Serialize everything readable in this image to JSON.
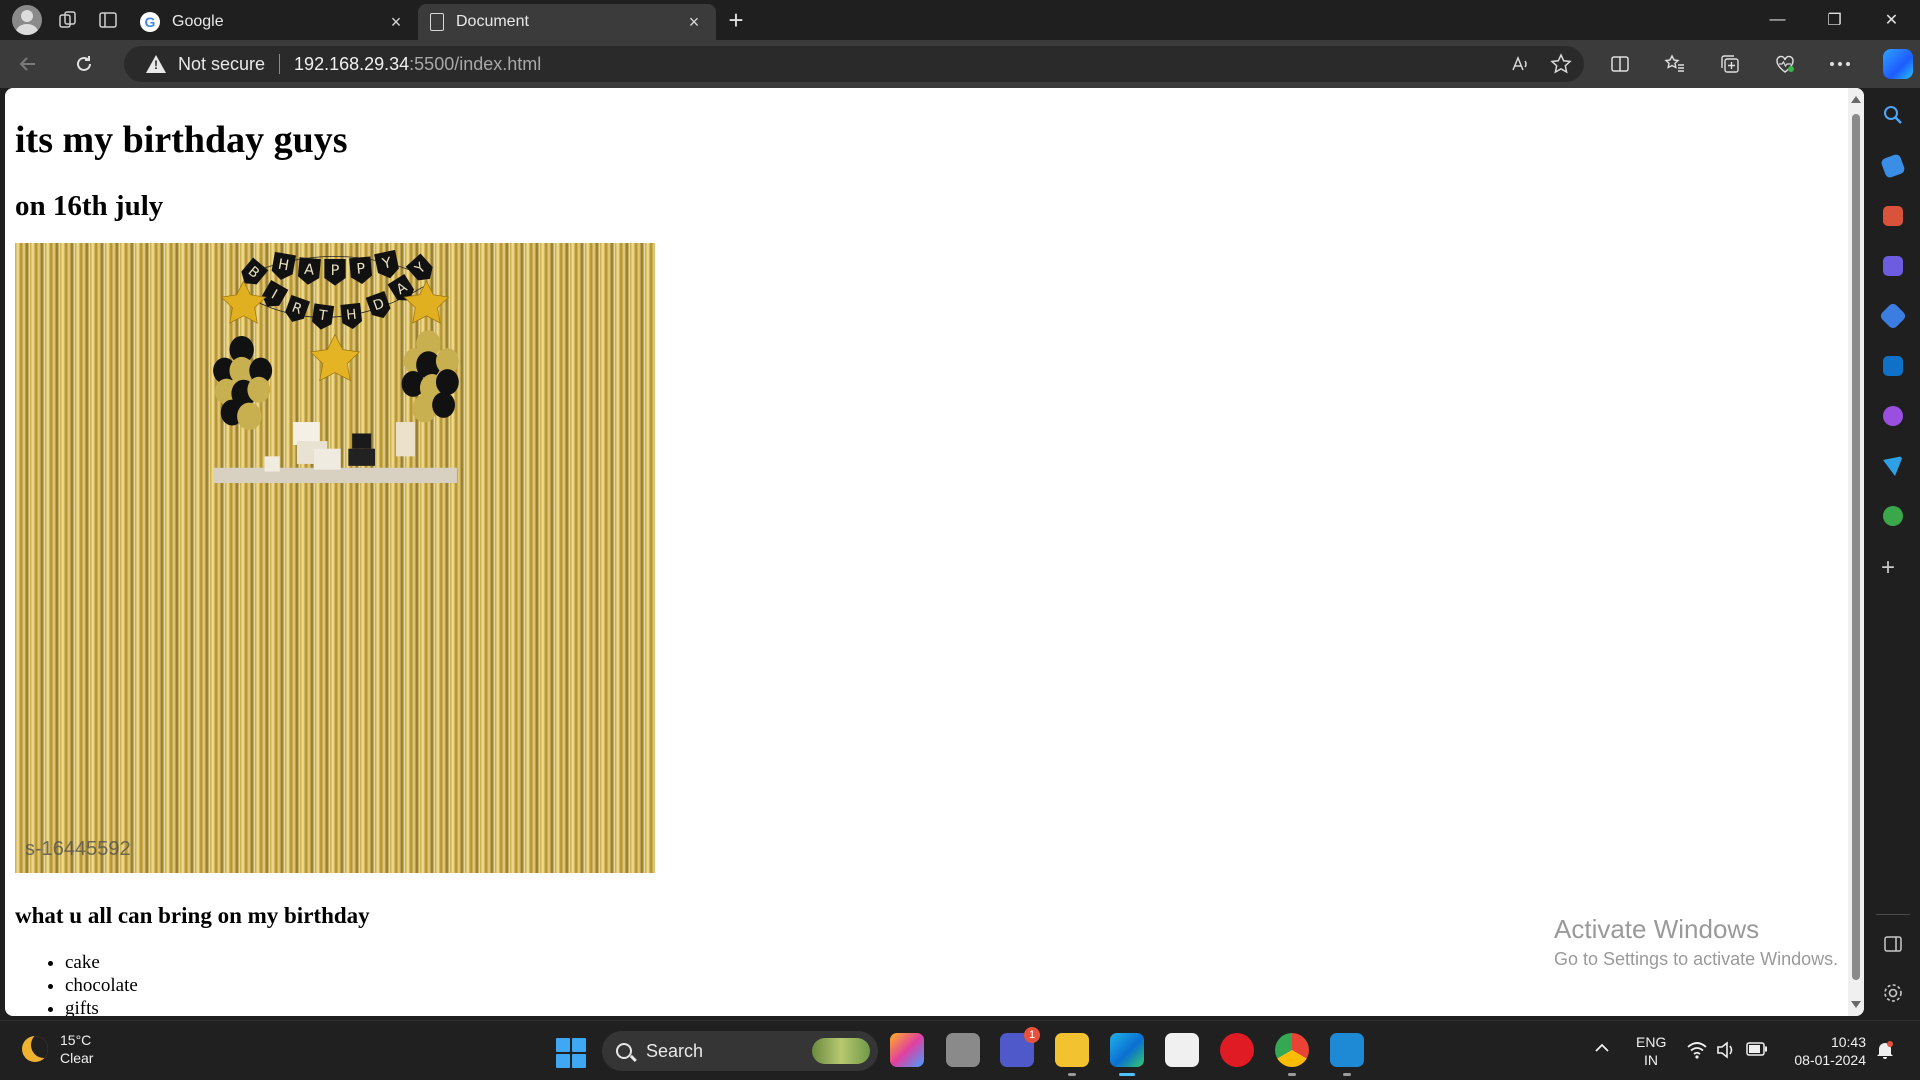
{
  "browser": {
    "tabs": [
      {
        "title": "Google",
        "active": false
      },
      {
        "title": "Document",
        "active": true
      }
    ],
    "close_glyph": "×",
    "new_tab_glyph": "+",
    "security_label": "Not secure",
    "url_host": "192.168.29.34",
    "url_path": ":5500/index.html",
    "window_controls": {
      "minimize": "—",
      "restore": "❐",
      "close": "✕"
    }
  },
  "page": {
    "heading1": "its my birthday guys",
    "heading2": "on 16th july",
    "image_watermark": "s-16445592",
    "heading3": "what u all can bring on my birthday",
    "list_items": [
      "cake",
      "chocolate",
      "gifts"
    ]
  },
  "banner_letters_top": [
    "H",
    "A",
    "P",
    "P",
    "Y"
  ],
  "banner_letters_bottom": [
    "B",
    "I",
    "R",
    "T",
    "H",
    "D",
    "A",
    "Y"
  ],
  "windows_watermark": {
    "line1": "Activate Windows",
    "line2": "Go to Settings to activate Windows."
  },
  "taskbar": {
    "weather_temp": "15°C",
    "weather_desc": "Clear",
    "search_label": "Search",
    "teams_badge": "1",
    "lang_line1": "ENG",
    "lang_line2": "IN",
    "time": "10:43",
    "date": "08-01-2024"
  },
  "colors": {
    "accent": "#4cc2ff",
    "tab_active_bg": "#3b3b3b",
    "chrome_bg": "#1f1f1f"
  }
}
